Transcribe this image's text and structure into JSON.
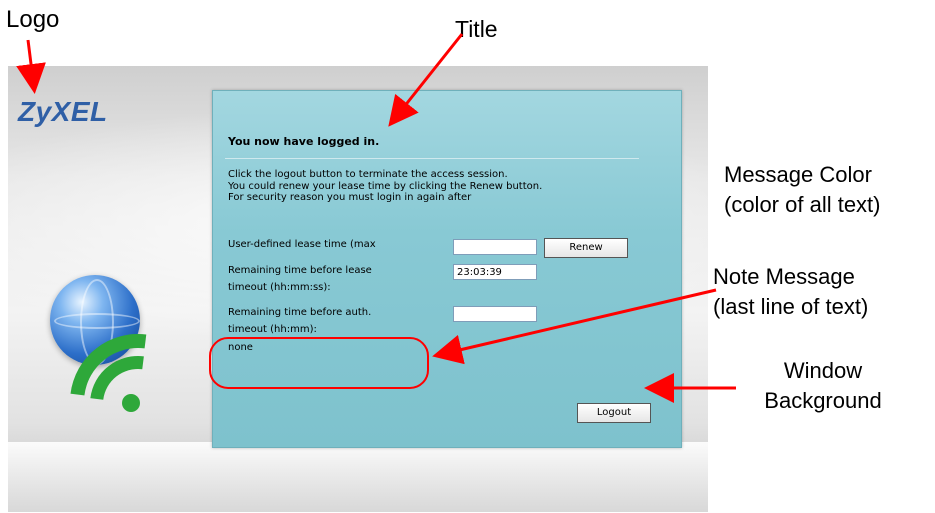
{
  "annotations": {
    "logo": "Logo",
    "title": "Title",
    "message_color_line1": "Message Color",
    "message_color_line2": "(color of all text)",
    "note_message_line1": "Note Message",
    "note_message_line2": "(last line of text)",
    "window_background_line1": "Window",
    "window_background_line2": "Background"
  },
  "app": {
    "logo_text": "ZyXEL"
  },
  "panel": {
    "title": "You now have logged in.",
    "description_line1": "Click the logout button to terminate the access session.",
    "description_line2": "You could renew your lease time by clicking the Renew button.",
    "description_line3": "For security reason you must login in again after",
    "lease_time_label": "User-defined lease time (max",
    "lease_time_value": "",
    "renew_button": "Renew",
    "remaining_lease_label_line1": "Remaining time before lease",
    "remaining_lease_label_line2": "timeout (hh:mm:ss):",
    "remaining_lease_value": "23:03:39",
    "remaining_auth_label_line1": "Remaining time before auth.",
    "remaining_auth_label_line2": "timeout (hh:mm):",
    "remaining_auth_value": "",
    "note_message": "none",
    "logout_button": "Logout"
  },
  "colors": {
    "annotation_red": "#ff0000",
    "panel_background": "#88c9d4",
    "logo_blue": "#2f5fa6",
    "wifi_green": "#2ea83a"
  },
  "icons": [
    "globe-icon",
    "wifi-icon"
  ]
}
